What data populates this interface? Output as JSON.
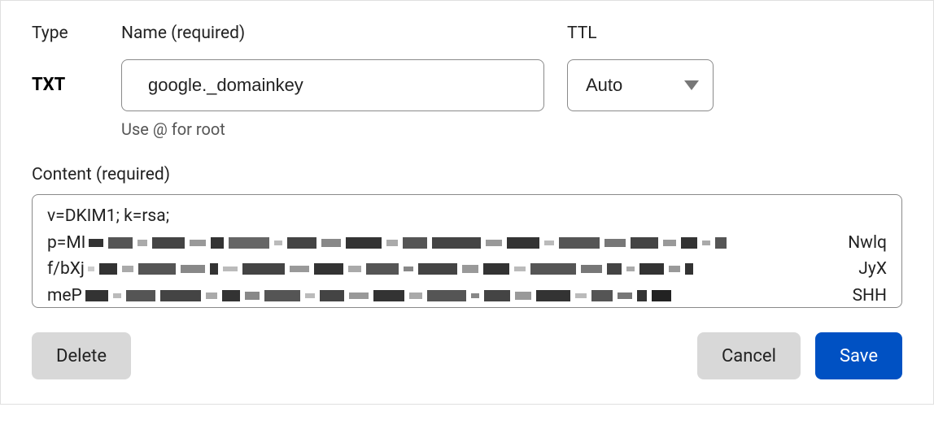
{
  "labels": {
    "type": "Type",
    "name": "Name (required)",
    "ttl": "TTL",
    "content": "Content (required)",
    "name_help": "Use @ for root"
  },
  "record": {
    "type": "TXT",
    "name": "google._domainkey",
    "ttl": "Auto",
    "content_line1": "v=DKIM1; k=rsa;",
    "content_l2_prefix": "p=MI",
    "content_l2_suffix": "Nwlq",
    "content_l3_prefix": "f/bXj",
    "content_l3_suffix": "JyX",
    "content_l4_prefix": "meP",
    "content_l4_suffix": "SHH"
  },
  "buttons": {
    "delete": "Delete",
    "cancel": "Cancel",
    "save": "Save"
  }
}
